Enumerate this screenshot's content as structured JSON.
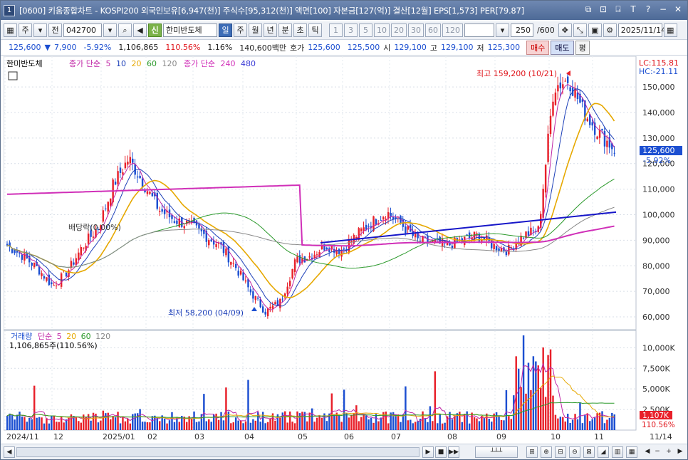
{
  "window": {
    "number": "1",
    "title": "[0600] 키움종합차트 - KOSPI200 외국인보유[6,947(천)] 주식수[95,312(천)] 액면[100] 자본금[127(억)] 결산[12월] EPS[1,573] PER[79.87]",
    "title_icons": [
      "⧉",
      "⊡",
      "⍈",
      "T",
      "?",
      "−",
      "✕"
    ]
  },
  "toolbar": {
    "period_label": "주",
    "prev_label": "전",
    "code": "042700",
    "stock_badge": "신",
    "stock_name": "한미반도체",
    "periods": [
      "일",
      "주",
      "월",
      "년",
      "분",
      "초",
      "틱"
    ],
    "active_period": "일",
    "intervals": [
      "1",
      "3",
      "5",
      "10",
      "20",
      "30",
      "60",
      "120"
    ],
    "count_value": "250",
    "count_total": "/600",
    "date": "2025/11/14"
  },
  "quote": {
    "price": "125,600",
    "change_arrow": "▼",
    "change": "7,900",
    "change_pct": "-5.92%",
    "volume": "1,106,865",
    "volume_ratio": "110.56%",
    "turnover": "1.16%",
    "amount": "140,600백만",
    "bid_label": "호가",
    "bid": "125,600",
    "ask": "125,500",
    "open_label": "시",
    "open": "129,100",
    "high_label": "고",
    "high": "129,100",
    "low_label": "저",
    "low": "125,300",
    "buy_label": "매수",
    "sell_label": "매도",
    "p_label": "평"
  },
  "price_legend": {
    "name": "한미반도체",
    "ma_label": "종가 단순",
    "ma_periods": [
      "5",
      "10",
      "20",
      "60",
      "120"
    ],
    "ma_label2": "종가 단순",
    "ma_periods2": [
      "240",
      "480"
    ]
  },
  "volume_legend": {
    "label": "거래량",
    "ma_label": "단순",
    "ma_periods": [
      "5",
      "20",
      "60",
      "120"
    ],
    "value": "1,106,865주(110.56%)"
  },
  "annotations": {
    "high": "최고 159,200 (10/21)",
    "low": "최저 58,200 (04/09)",
    "dividend": "배당락(0.00%)",
    "lc": "LC:115.81",
    "hc": "HC:-21.11",
    "price_tag": "125,600",
    "pct_tag": "-5.92%",
    "vol_tag": "1,107K",
    "vol_pct_tag": "110.56%"
  },
  "axis": {
    "price_ticks": [
      "150,000",
      "140,000",
      "130,000",
      "120,000",
      "110,000",
      "100,000",
      "90,000",
      "80,000",
      "70,000",
      "60,000"
    ],
    "volume_ticks": [
      "10,000K",
      "7,500K",
      "5,000K",
      "2,500K"
    ],
    "x_ticks": [
      "2024/11",
      "12",
      "2025/01",
      "02",
      "03",
      "04",
      "05",
      "06",
      "07",
      "08",
      "09",
      "10",
      "11",
      "11/14"
    ]
  },
  "colors": {
    "up": "#e8202a",
    "down": "#1c4fd1",
    "ma5": "#c026a6",
    "ma10": "#1c3fb8",
    "ma20": "#e6a800",
    "ma60": "#2c9a2c",
    "ma120": "#888888",
    "ma240": "#d02fb8",
    "ma480": "#3b3bd6",
    "trend": "#1616c8"
  },
  "chart_data": {
    "type": "candlestick",
    "ylim": [
      55000,
      162000
    ],
    "x": [
      "2024/11",
      "12",
      "2025/01",
      "02",
      "03",
      "04",
      "05",
      "06",
      "07",
      "08",
      "09",
      "10",
      "11"
    ],
    "close_path": [
      88000,
      84000,
      79000,
      72000,
      78000,
      88000,
      95000,
      112000,
      122000,
      112000,
      102000,
      98000,
      96000,
      92000,
      88000,
      80000,
      70000,
      62000,
      66000,
      82000,
      84000,
      88000,
      86000,
      92000,
      97000,
      101000,
      96000,
      90000,
      89000,
      88000,
      90000,
      92000,
      88000,
      86000,
      92000,
      94000,
      150000,
      153000,
      140000,
      132000,
      125600
    ],
    "high": 159200,
    "high_date": "10/21",
    "low": 58200,
    "low_date": "04/09",
    "last": 125600
  }
}
